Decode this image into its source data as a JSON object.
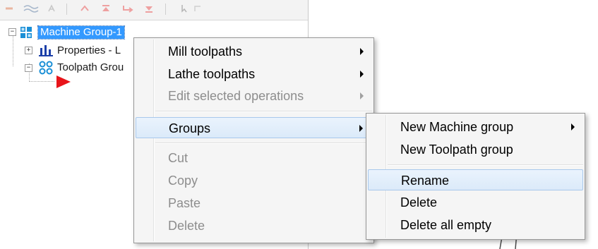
{
  "tree": {
    "items": [
      {
        "label": "Machine Group-1",
        "selected": true,
        "icon": "machine-group-icon"
      },
      {
        "label": "Properties - L",
        "icon": "properties-icon"
      },
      {
        "label": "Toolpath Grou",
        "icon": "toolpath-group-icon"
      }
    ],
    "insert_marker_icon": "insert-arrow-icon"
  },
  "context_menu": {
    "items": [
      {
        "label": "Mill toolpaths",
        "disabled": false,
        "submenu": true
      },
      {
        "label": "Lathe toolpaths",
        "disabled": false,
        "submenu": true
      },
      {
        "label": "Edit selected operations",
        "disabled": true,
        "submenu": true
      },
      {
        "label": "Groups",
        "disabled": false,
        "submenu": true,
        "highlighted": true
      },
      {
        "label": "Cut",
        "disabled": true
      },
      {
        "label": "Copy",
        "disabled": true
      },
      {
        "label": "Paste",
        "disabled": true
      },
      {
        "label": "Delete",
        "disabled": true
      }
    ]
  },
  "groups_submenu": {
    "items": [
      {
        "label": "New Machine group",
        "submenu": true
      },
      {
        "label": "New Toolpath group"
      },
      {
        "label": "Rename",
        "highlighted": true
      },
      {
        "label": "Delete"
      },
      {
        "label": "Delete all empty"
      }
    ]
  },
  "colors": {
    "selection": "#3399ff",
    "menu_background": "#f5f5f5",
    "highlight": "#dbeaf9",
    "disabled_text": "#8d8d8d",
    "insert_arrow": "#e8141a"
  }
}
